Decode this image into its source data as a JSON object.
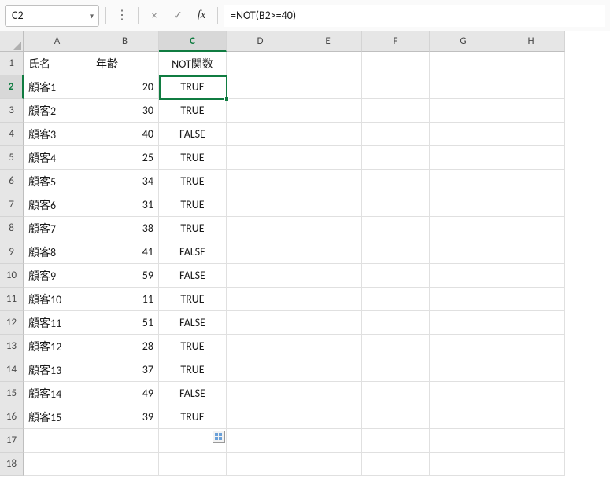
{
  "formula_bar": {
    "name_box": "C2",
    "cancel_icon": "×",
    "accept_icon": "✓",
    "fx_label": "fx",
    "formula": "=NOT(B2>=40)"
  },
  "columns": [
    "A",
    "B",
    "C",
    "D",
    "E",
    "F",
    "G",
    "H"
  ],
  "active": {
    "col_index": 2,
    "row_index": 1,
    "cell_ref": "C2"
  },
  "headers": {
    "A": "氏名",
    "B": "年齢",
    "C": "NOT関数"
  },
  "rows": [
    {
      "name": "顧客1",
      "age": "20",
      "not": "TRUE"
    },
    {
      "name": "顧客2",
      "age": "30",
      "not": "TRUE"
    },
    {
      "name": "顧客3",
      "age": "40",
      "not": "FALSE"
    },
    {
      "name": "顧客4",
      "age": "25",
      "not": "TRUE"
    },
    {
      "name": "顧客5",
      "age": "34",
      "not": "TRUE"
    },
    {
      "name": "顧客6",
      "age": "31",
      "not": "TRUE"
    },
    {
      "name": "顧客7",
      "age": "38",
      "not": "TRUE"
    },
    {
      "name": "顧客8",
      "age": "41",
      "not": "FALSE"
    },
    {
      "name": "顧客9",
      "age": "59",
      "not": "FALSE"
    },
    {
      "name": "顧客10",
      "age": "11",
      "not": "TRUE"
    },
    {
      "name": "顧客11",
      "age": "51",
      "not": "FALSE"
    },
    {
      "name": "顧客12",
      "age": "28",
      "not": "TRUE"
    },
    {
      "name": "顧客13",
      "age": "37",
      "not": "TRUE"
    },
    {
      "name": "顧客14",
      "age": "49",
      "not": "FALSE"
    },
    {
      "name": "顧客15",
      "age": "39",
      "not": "TRUE"
    }
  ],
  "visible_row_count": 18,
  "chart_data": {
    "type": "table",
    "columns": [
      "氏名",
      "年齢",
      "NOT関数"
    ],
    "data": [
      [
        "顧客1",
        20,
        true
      ],
      [
        "顧客2",
        30,
        true
      ],
      [
        "顧客3",
        40,
        false
      ],
      [
        "顧客4",
        25,
        true
      ],
      [
        "顧客5",
        34,
        true
      ],
      [
        "顧客6",
        31,
        true
      ],
      [
        "顧客7",
        38,
        true
      ],
      [
        "顧客8",
        41,
        false
      ],
      [
        "顧客9",
        59,
        false
      ],
      [
        "顧客10",
        11,
        true
      ],
      [
        "顧客11",
        51,
        false
      ],
      [
        "顧客12",
        28,
        true
      ],
      [
        "顧客13",
        37,
        true
      ],
      [
        "顧客14",
        49,
        false
      ],
      [
        "顧客15",
        39,
        true
      ]
    ]
  }
}
